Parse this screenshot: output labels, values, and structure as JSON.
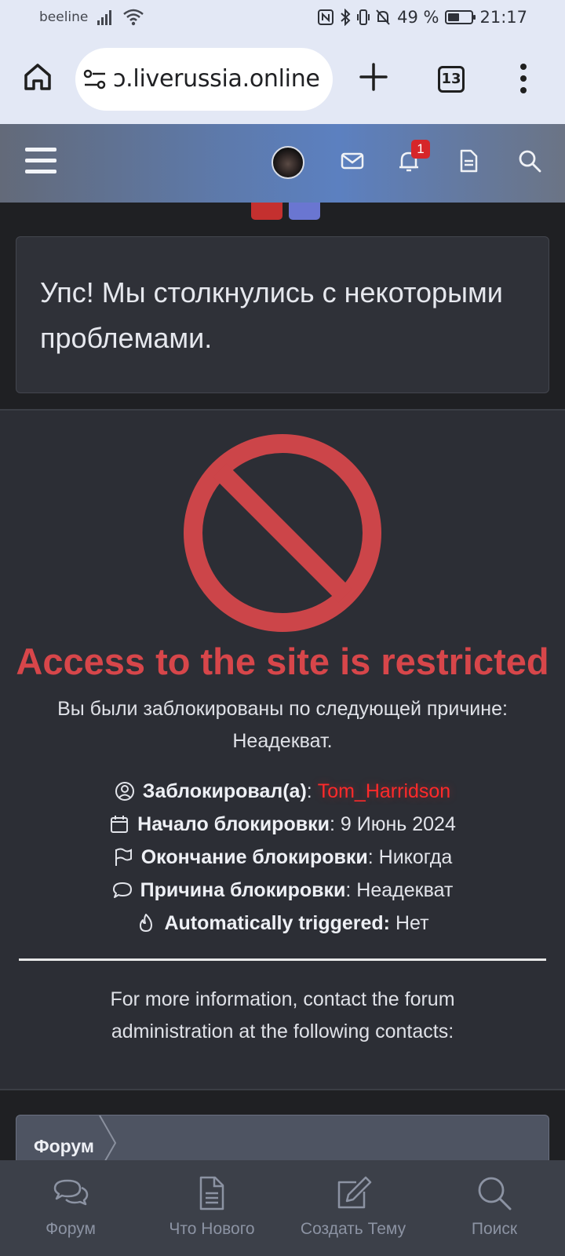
{
  "status_bar": {
    "carrier": "beeline",
    "battery_text": "49 %",
    "battery_level": 0.49,
    "time": "21:17",
    "icons": [
      "signal-icon",
      "wifi-icon",
      "nfc-icon",
      "bluetooth-icon",
      "vibrate-icon",
      "mute-icon",
      "battery-icon"
    ]
  },
  "browser": {
    "url": "ɔ.liverussia.online",
    "tab_count": "13",
    "icons": [
      "home-icon",
      "site-settings-icon",
      "new-tab-icon",
      "tabs-icon",
      "menu-icon"
    ]
  },
  "header": {
    "notification_count": "1",
    "icons": [
      "hamburger-menu-icon",
      "avatar",
      "mail-icon",
      "bell-icon",
      "document-icon",
      "search-icon"
    ]
  },
  "notice": {
    "text": "Упс! Мы столкнулись с некоторыми проблемами."
  },
  "block": {
    "title": "Access to the site is restricted",
    "reason_line": "Вы были заблокированы по следующей причине: Неадекват.",
    "blocked_by_label": "Заблокировал(а)",
    "blocked_by_value": "Tom_Harridson",
    "start_label": "Начало блокировки",
    "start_value": "9 Июнь 2024",
    "end_label": "Окончание блокировки",
    "end_value": "Никогда",
    "reason_label": "Причина блокировки",
    "reason_value": "Неадекват",
    "auto_label": "Automatically triggered:",
    "auto_value": "Нет",
    "contact_text": "For more information, contact the forum administration at the following contacts:"
  },
  "breadcrumb": {
    "label": "Форум"
  },
  "bottom_nav": {
    "items": [
      {
        "label": "Форум",
        "icon": "chat-bubbles-icon"
      },
      {
        "label": "Что Нового",
        "icon": "document-icon"
      },
      {
        "label": "Создать Тему",
        "icon": "edit-icon"
      },
      {
        "label": "Поиск",
        "icon": "search-icon"
      }
    ]
  },
  "colors": {
    "accent_red": "#d7464a",
    "blocker_name": "#ff2a2a",
    "badge_red": "#d6262a",
    "panel_bg": "#2c2e35",
    "nav_bg": "#3c4049"
  }
}
